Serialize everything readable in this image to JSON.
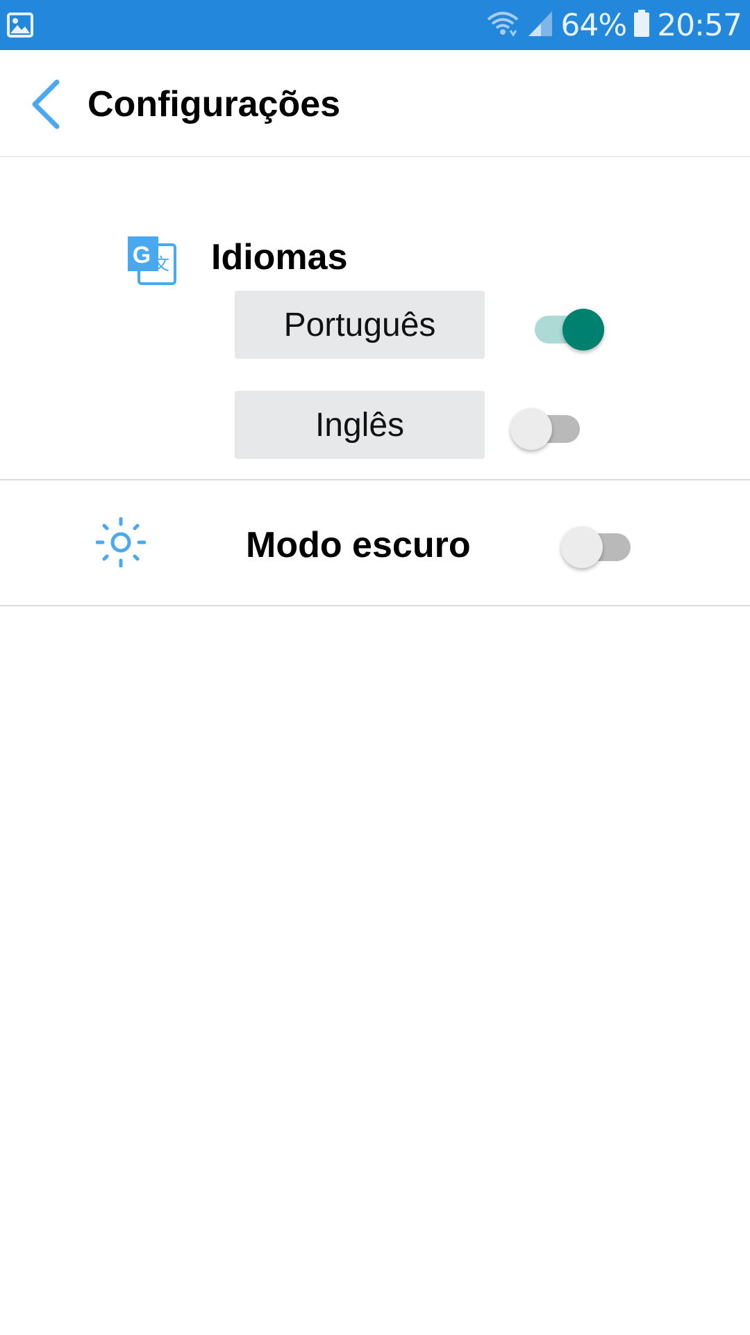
{
  "status_bar": {
    "battery_percent": "64%",
    "time": "20:57",
    "icons": [
      "gallery-icon",
      "wifi-icon",
      "signal-icon",
      "battery-icon"
    ]
  },
  "header": {
    "title": "Configurações",
    "back_icon": "chevron-left-icon"
  },
  "languages": {
    "title": "Idiomas",
    "icon": "translate-icon",
    "options": [
      {
        "label": "Português",
        "enabled": true
      },
      {
        "label": "Inglês",
        "enabled": false
      }
    ]
  },
  "dark_mode": {
    "label": "Modo escuro",
    "icon": "sun-icon",
    "enabled": false
  },
  "colors": {
    "status_bar": "#2388dc",
    "accent_blue": "#4aa8ee",
    "switch_on": "#00806f",
    "switch_on_track": "#9fd3cc",
    "button_bg": "#e6e8ea"
  }
}
